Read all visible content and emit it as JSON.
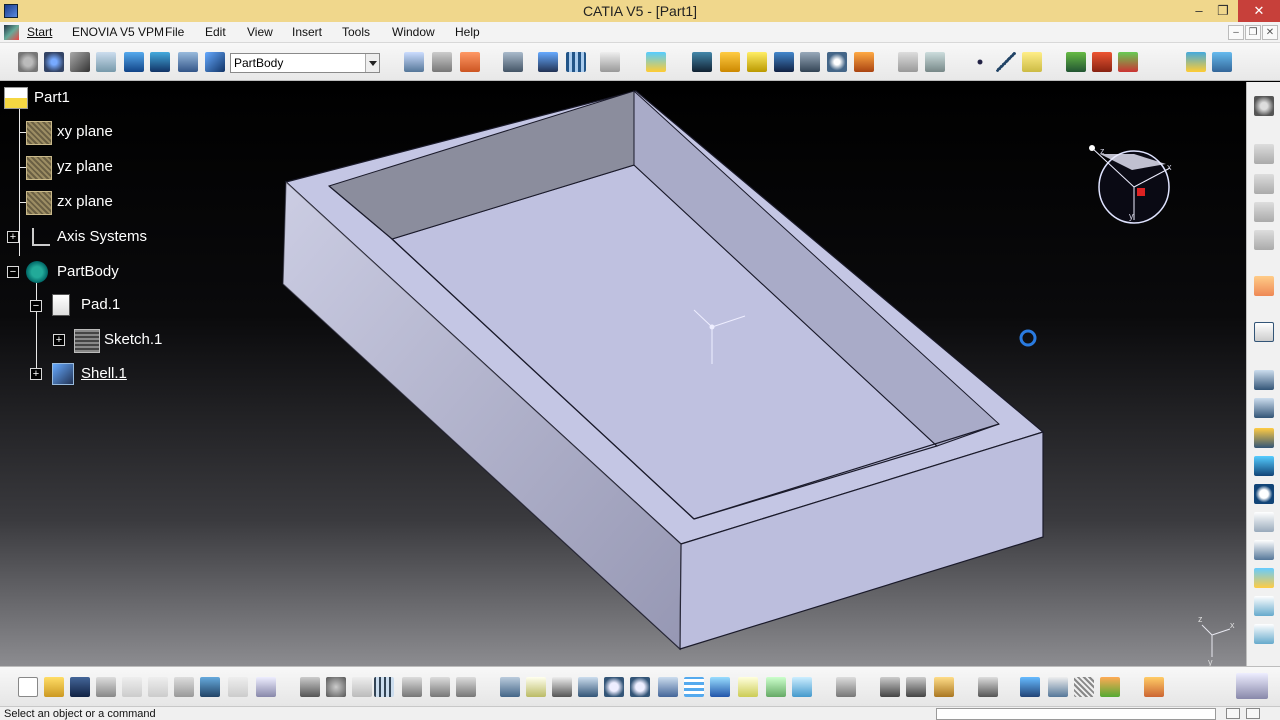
{
  "window": {
    "title": "CATIA V5 - [Part1]",
    "minimize": "–",
    "maximize": "❐",
    "close": "✕"
  },
  "menubar": {
    "items": [
      "Start",
      "ENOVIA V5 VPM",
      "File",
      "Edit",
      "View",
      "Insert",
      "Tools",
      "Window",
      "Help"
    ],
    "mdi_minimize": "–",
    "mdi_restore": "❐",
    "mdi_close": "✕"
  },
  "toolbar": {
    "current_body": "PartBody"
  },
  "tree": {
    "root": "Part1",
    "xy_plane": "xy plane",
    "yz_plane": "yz plane",
    "zx_plane": "zx plane",
    "axis_systems": "Axis Systems",
    "part_body": "PartBody",
    "pad": "Pad.1",
    "sketch": "Sketch.1",
    "shell": "Shell.1"
  },
  "compass_labels": {
    "x": "x",
    "y": "y",
    "z": "z"
  },
  "triad_labels": {
    "x": "x",
    "y": "y",
    "z": "z"
  },
  "colors": {
    "part_face_top": "#c4c6e4",
    "part_face_left": "#b0b2d4",
    "part_face_front": "#bcbedd",
    "part_inner_wall": "#888a99",
    "tree_text": "#ffffff"
  },
  "status": {
    "message": "Select an object or a command"
  }
}
